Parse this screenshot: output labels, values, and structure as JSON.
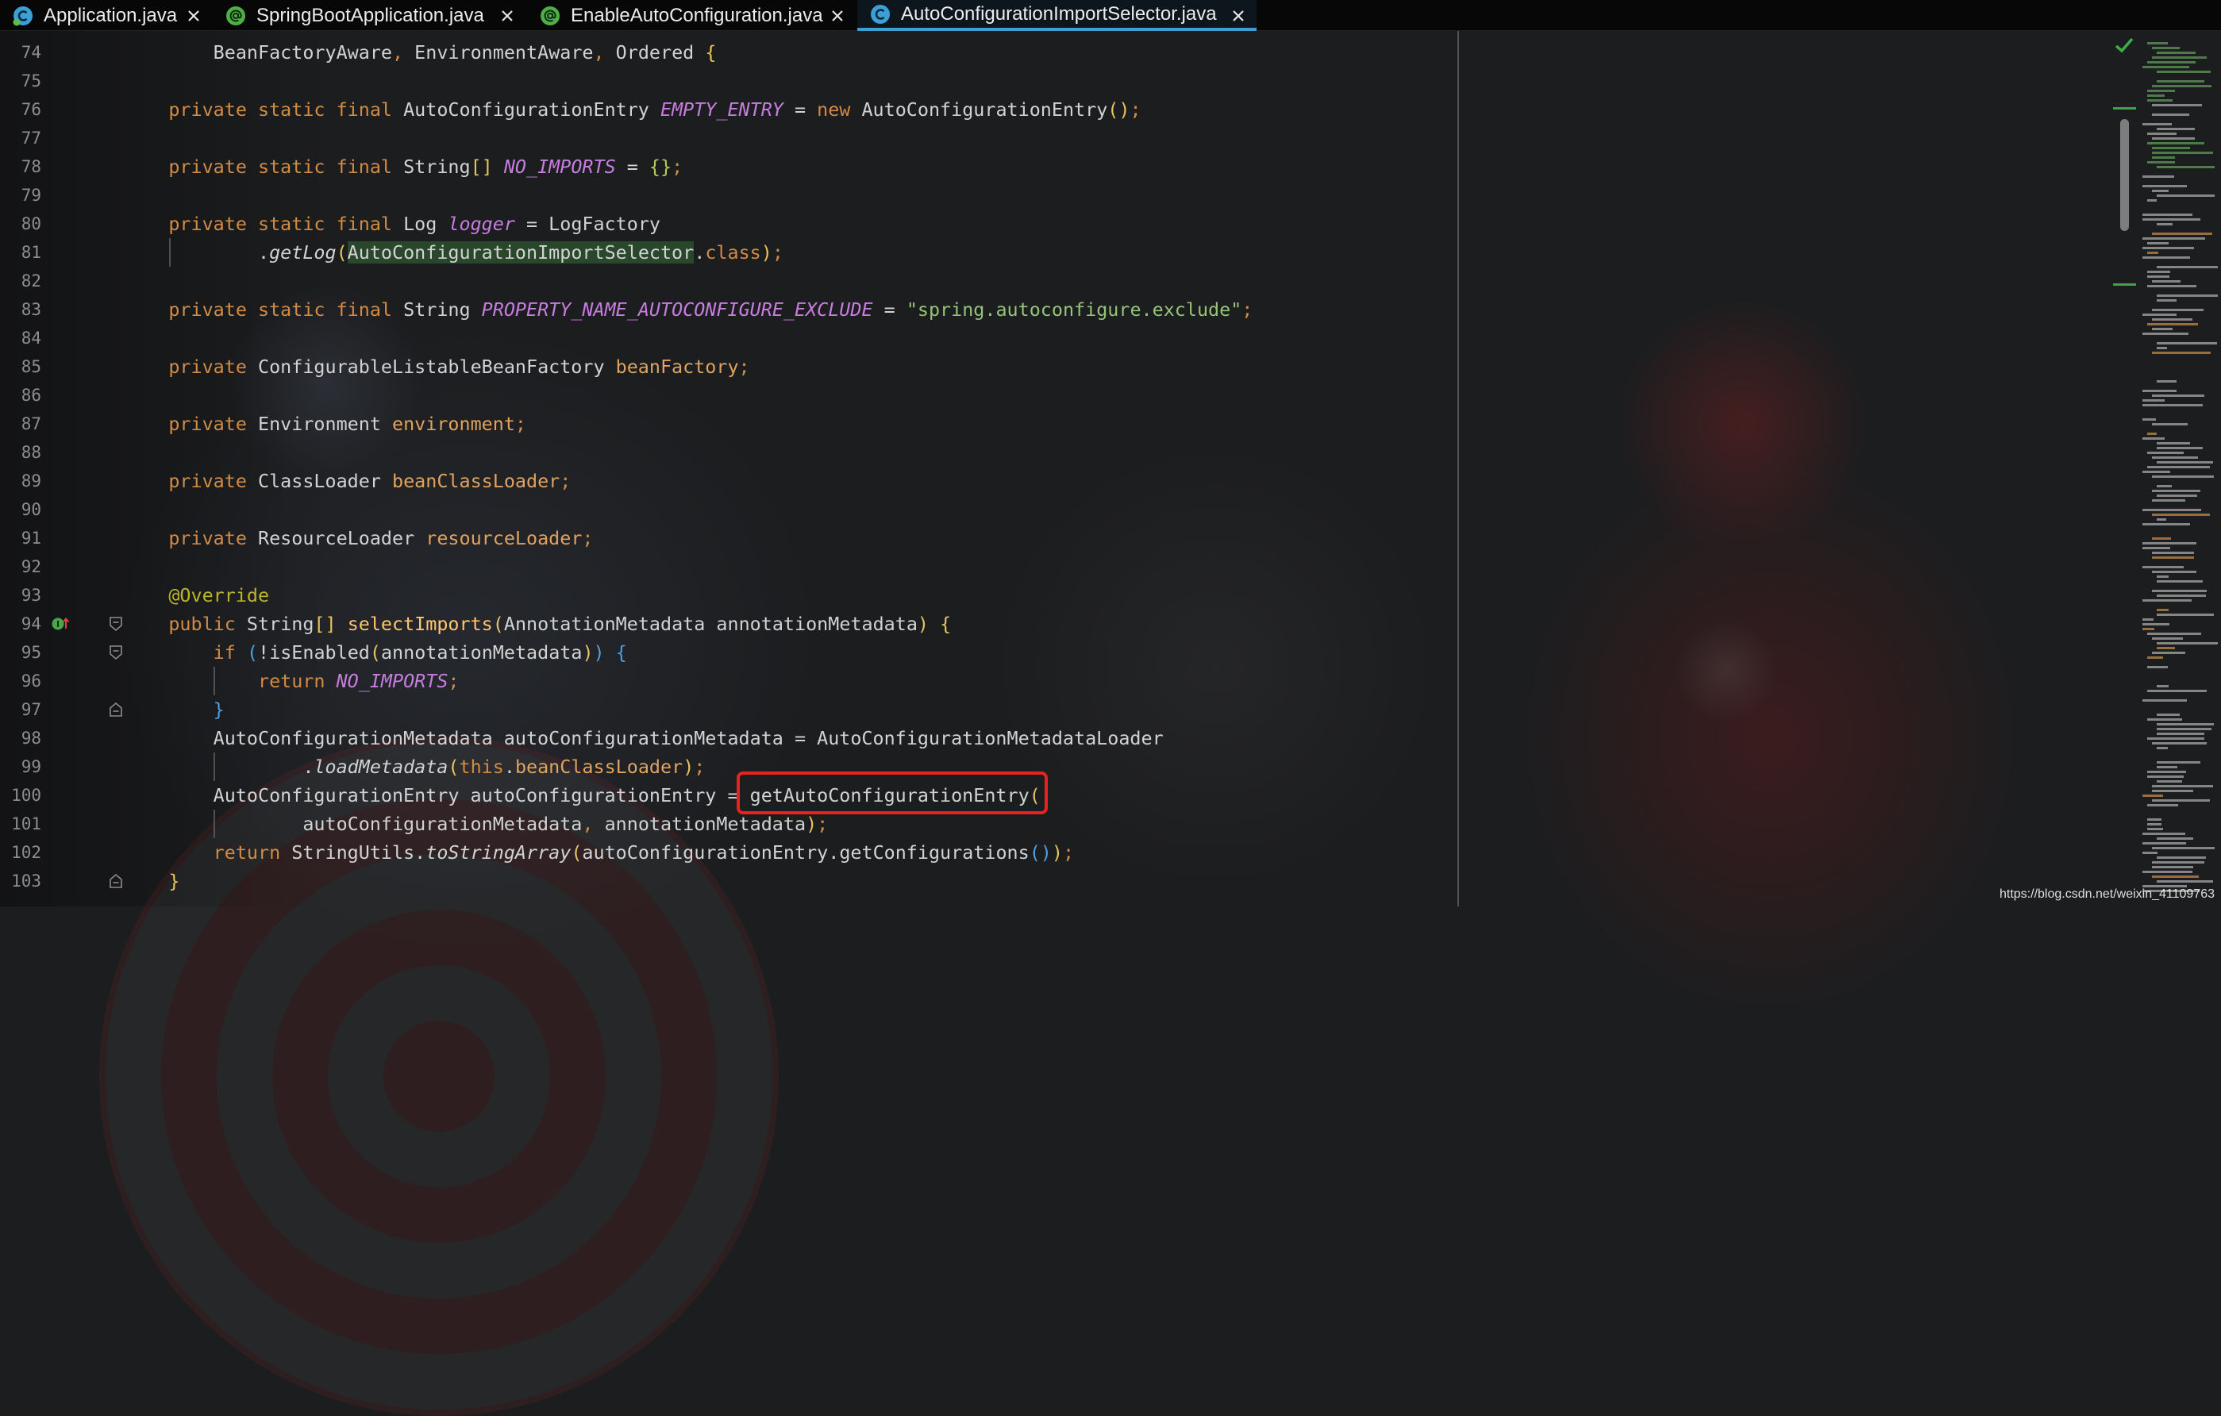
{
  "tabs": [
    {
      "label": "Application.java",
      "icon": "spring-boot-class-icon",
      "active": false
    },
    {
      "label": "SpringBootApplication.java",
      "icon": "annotation-icon",
      "active": false
    },
    {
      "label": "EnableAutoConfiguration.java",
      "icon": "annotation-icon",
      "active": false
    },
    {
      "label": "AutoConfigurationImportSelector.java",
      "icon": "class-icon",
      "active": true
    }
  ],
  "colors": {
    "active_tab_underline": "#3aa0d0",
    "highlight_box": "#e8231e"
  },
  "syntax_colors": {
    "plain": "#d2d2d2",
    "keyword": "#d28b44",
    "separator": "#d28b44",
    "const": "#c77dde",
    "field": "#e0a25f",
    "string": "#93c477",
    "annotation": "#bbb529",
    "method": "#ffc66d",
    "italic": "#d2d2d2",
    "bracket1": "#e6c35c",
    "bracket2": "#4e9fe0",
    "bracket3": "#b9c765",
    "highlight": "#d2d2d2",
    "highlight_background": "#28472b"
  },
  "editor": {
    "lines": [
      {
        "number": "74",
        "tokens": [
          [
            "        ",
            "plain"
          ],
          [
            "BeanFactoryAware",
            "plain"
          ],
          [
            ",",
            "separator"
          ],
          [
            " EnvironmentAware",
            "plain"
          ],
          [
            ",",
            "separator"
          ],
          [
            " Ordered ",
            "plain"
          ],
          [
            "{",
            "bracket1"
          ]
        ]
      },
      {
        "number": "75",
        "tokens": []
      },
      {
        "number": "76",
        "tokens": [
          [
            "    ",
            "plain"
          ],
          [
            "private static final",
            "keyword"
          ],
          [
            " AutoConfigurationEntry ",
            "plain"
          ],
          [
            "EMPTY_ENTRY",
            "const"
          ],
          [
            " = ",
            "plain"
          ],
          [
            "new",
            "keyword"
          ],
          [
            " AutoConfigurationEntry",
            "plain"
          ],
          [
            "()",
            "bracket1"
          ],
          [
            ";",
            "separator"
          ]
        ]
      },
      {
        "number": "77",
        "tokens": []
      },
      {
        "number": "78",
        "tokens": [
          [
            "    ",
            "plain"
          ],
          [
            "private static final",
            "keyword"
          ],
          [
            " String",
            "plain"
          ],
          [
            "[]",
            "bracket1"
          ],
          [
            " ",
            "plain"
          ],
          [
            "NO_IMPORTS",
            "const"
          ],
          [
            " = ",
            "plain"
          ],
          [
            "{}",
            "bracket3"
          ],
          [
            ";",
            "separator"
          ]
        ]
      },
      {
        "number": "79",
        "tokens": []
      },
      {
        "number": "80",
        "tokens": [
          [
            "    ",
            "plain"
          ],
          [
            "private static final",
            "keyword"
          ],
          [
            " Log ",
            "plain"
          ],
          [
            "logger",
            "const"
          ],
          [
            " = LogFactory",
            "plain"
          ]
        ]
      },
      {
        "number": "81",
        "tokens": [
          [
            "            .",
            "plain"
          ],
          [
            "getLog",
            "italic"
          ],
          [
            "(",
            "bracket1"
          ],
          [
            "AutoConfigurationImportSelector",
            "highlight"
          ],
          [
            ".",
            "plain"
          ],
          [
            "class",
            "keyword"
          ],
          [
            ")",
            "bracket1"
          ],
          [
            ";",
            "separator"
          ]
        ]
      },
      {
        "number": "82",
        "tokens": []
      },
      {
        "number": "83",
        "tokens": [
          [
            "    ",
            "plain"
          ],
          [
            "private static final",
            "keyword"
          ],
          [
            " String ",
            "plain"
          ],
          [
            "PROPERTY_NAME_AUTOCONFIGURE_EXCLUDE",
            "const"
          ],
          [
            " = ",
            "plain"
          ],
          [
            "\"spring.autoconfigure.exclude\"",
            "string"
          ],
          [
            ";",
            "separator"
          ]
        ]
      },
      {
        "number": "84",
        "tokens": []
      },
      {
        "number": "85",
        "tokens": [
          [
            "    ",
            "plain"
          ],
          [
            "private",
            "keyword"
          ],
          [
            " ConfigurableListableBeanFactory ",
            "plain"
          ],
          [
            "beanFactory",
            "field"
          ],
          [
            ";",
            "separator"
          ]
        ]
      },
      {
        "number": "86",
        "tokens": []
      },
      {
        "number": "87",
        "tokens": [
          [
            "    ",
            "plain"
          ],
          [
            "private",
            "keyword"
          ],
          [
            " Environment ",
            "plain"
          ],
          [
            "environment",
            "field"
          ],
          [
            ";",
            "separator"
          ]
        ]
      },
      {
        "number": "88",
        "tokens": []
      },
      {
        "number": "89",
        "tokens": [
          [
            "    ",
            "plain"
          ],
          [
            "private",
            "keyword"
          ],
          [
            " ClassLoader ",
            "plain"
          ],
          [
            "beanClassLoader",
            "field"
          ],
          [
            ";",
            "separator"
          ]
        ]
      },
      {
        "number": "90",
        "tokens": []
      },
      {
        "number": "91",
        "tokens": [
          [
            "    ",
            "plain"
          ],
          [
            "private",
            "keyword"
          ],
          [
            " ResourceLoader ",
            "plain"
          ],
          [
            "resourceLoader",
            "field"
          ],
          [
            ";",
            "separator"
          ]
        ]
      },
      {
        "number": "92",
        "tokens": []
      },
      {
        "number": "93",
        "tokens": [
          [
            "    ",
            "plain"
          ],
          [
            "@Override",
            "annotation"
          ]
        ]
      },
      {
        "number": "94",
        "gutter_icons": [
          "implements-method-icon",
          "fold-start-icon"
        ],
        "tokens": [
          [
            "    ",
            "plain"
          ],
          [
            "public",
            "keyword"
          ],
          [
            " String",
            "plain"
          ],
          [
            "[]",
            "bracket1"
          ],
          [
            " ",
            "plain"
          ],
          [
            "selectImports",
            "method"
          ],
          [
            "(",
            "bracket1"
          ],
          [
            "AnnotationMetadata annotationMetadata",
            "plain"
          ],
          [
            ")",
            "bracket1"
          ],
          [
            " ",
            "plain"
          ],
          [
            "{",
            "bracket1"
          ]
        ]
      },
      {
        "number": "95",
        "gutter_icons": [
          "fold-start-icon"
        ],
        "tokens": [
          [
            "        ",
            "plain"
          ],
          [
            "if",
            "keyword"
          ],
          [
            " ",
            "plain"
          ],
          [
            "(",
            "bracket2"
          ],
          [
            "!isEnabled",
            "plain"
          ],
          [
            "(",
            "bracket1"
          ],
          [
            "annotationMetadata",
            "plain"
          ],
          [
            ")",
            "bracket1"
          ],
          [
            ")",
            "bracket2"
          ],
          [
            " ",
            "plain"
          ],
          [
            "{",
            "bracket2"
          ]
        ]
      },
      {
        "number": "96",
        "tokens": [
          [
            "            ",
            "plain"
          ],
          [
            "return",
            "keyword"
          ],
          [
            " ",
            "plain"
          ],
          [
            "NO_IMPORTS",
            "const"
          ],
          [
            ";",
            "separator"
          ]
        ]
      },
      {
        "number": "97",
        "gutter_icons": [
          "fold-end-icon"
        ],
        "tokens": [
          [
            "        ",
            "plain"
          ],
          [
            "}",
            "bracket2"
          ]
        ]
      },
      {
        "number": "98",
        "tokens": [
          [
            "        AutoConfigurationMetadata autoConfigurationMetadata = AutoConfigurationMetadataLoader",
            "plain"
          ]
        ]
      },
      {
        "number": "99",
        "tokens": [
          [
            "                .",
            "plain"
          ],
          [
            "loadMetadata",
            "italic"
          ],
          [
            "(",
            "bracket1"
          ],
          [
            "this",
            "keyword"
          ],
          [
            ".",
            "plain"
          ],
          [
            "beanClassLoader",
            "field"
          ],
          [
            ")",
            "bracket1"
          ],
          [
            ";",
            "separator"
          ]
        ]
      },
      {
        "number": "100",
        "tokens": [
          [
            "        AutoConfigurationEntry autoConfigurationEntry = getAutoConfigurationEntry",
            "plain"
          ],
          [
            "(",
            "bracket1"
          ]
        ]
      },
      {
        "number": "101",
        "tokens": [
          [
            "                autoConfigurationMetadata",
            "plain"
          ],
          [
            ",",
            "separator"
          ],
          [
            " annotationMetadata",
            "plain"
          ],
          [
            ")",
            "bracket1"
          ],
          [
            ";",
            "separator"
          ]
        ]
      },
      {
        "number": "102",
        "tokens": [
          [
            "        ",
            "plain"
          ],
          [
            "return",
            "keyword"
          ],
          [
            " StringUtils.",
            "plain"
          ],
          [
            "toStringArray",
            "italic"
          ],
          [
            "(",
            "bracket1"
          ],
          [
            "autoConfigurationEntry.getConfigurations",
            "plain"
          ],
          [
            "()",
            "bracket2"
          ],
          [
            ")",
            "bracket1"
          ],
          [
            ";",
            "separator"
          ]
        ]
      },
      {
        "number": "103",
        "gutter_icons": [
          "fold-end-icon"
        ],
        "tokens": [
          [
            "    ",
            "plain"
          ],
          [
            "}",
            "bracket1"
          ]
        ]
      }
    ]
  },
  "watermark": "https://blog.csdn.net/weixin_41109763"
}
